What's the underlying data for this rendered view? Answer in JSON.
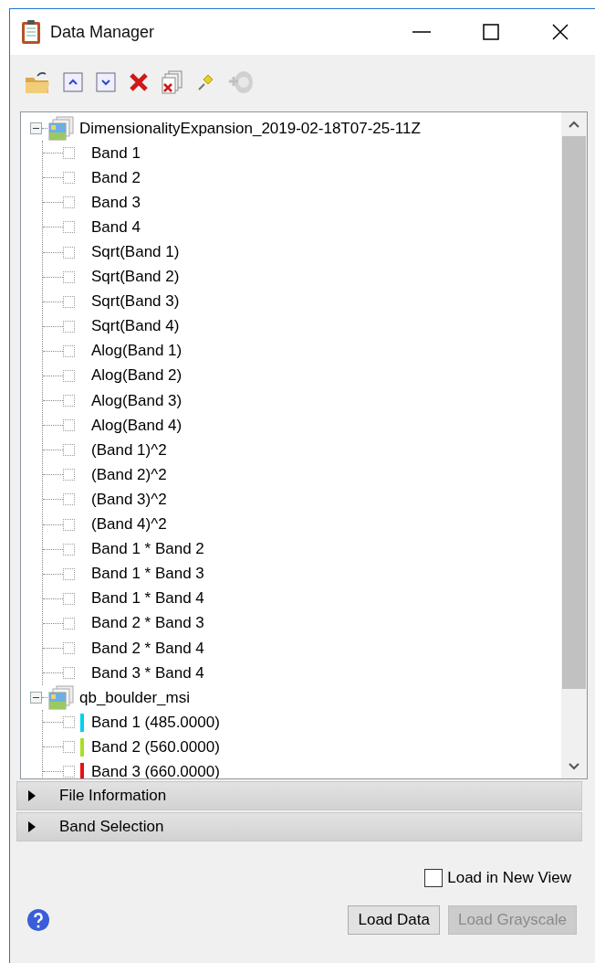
{
  "window": {
    "title": "Data Manager"
  },
  "tree": [
    {
      "label": "DimensionalityExpansion_2019-02-18T07-25-11Z",
      "expanded": true,
      "children": [
        {
          "label": "Band 1",
          "checked": false
        },
        {
          "label": "Band 2",
          "checked": false
        },
        {
          "label": "Band 3",
          "checked": false
        },
        {
          "label": "Band 4",
          "checked": false
        },
        {
          "label": "Sqrt(Band 1)",
          "checked": false
        },
        {
          "label": "Sqrt(Band 2)",
          "checked": false
        },
        {
          "label": "Sqrt(Band 3)",
          "checked": false
        },
        {
          "label": "Sqrt(Band 4)",
          "checked": false
        },
        {
          "label": "Alog(Band 1)",
          "checked": false
        },
        {
          "label": "Alog(Band 2)",
          "checked": false
        },
        {
          "label": "Alog(Band 3)",
          "checked": false
        },
        {
          "label": "Alog(Band 4)",
          "checked": false
        },
        {
          "label": "(Band 1)^2",
          "checked": false
        },
        {
          "label": "(Band 2)^2",
          "checked": false
        },
        {
          "label": "(Band 3)^2",
          "checked": false
        },
        {
          "label": "(Band 4)^2",
          "checked": false
        },
        {
          "label": "Band 1 * Band 2",
          "checked": false
        },
        {
          "label": "Band 1 * Band 3",
          "checked": false
        },
        {
          "label": "Band 1 * Band 4",
          "checked": false
        },
        {
          "label": "Band 2 * Band 3",
          "checked": false
        },
        {
          "label": "Band 2 * Band 4",
          "checked": false
        },
        {
          "label": "Band 3 * Band 4",
          "checked": false
        }
      ]
    },
    {
      "label": "qb_boulder_msi",
      "expanded": true,
      "children": [
        {
          "label": "Band 1 (485.0000)",
          "checked": false,
          "color": "#00d0f0"
        },
        {
          "label": "Band 2 (560.0000)",
          "checked": false,
          "color": "#a8e020"
        },
        {
          "label": "Band 3 (660.0000)",
          "checked": false,
          "color": "#e81010"
        }
      ]
    }
  ],
  "sections": [
    {
      "label": "File Information",
      "expanded": false
    },
    {
      "label": "Band Selection",
      "expanded": false
    }
  ],
  "load_in_new_view": {
    "label": "Load in New View",
    "checked": false
  },
  "buttons": [
    {
      "label": "Load Data",
      "disabled": false
    },
    {
      "label": "Load Grayscale",
      "disabled": true
    }
  ]
}
